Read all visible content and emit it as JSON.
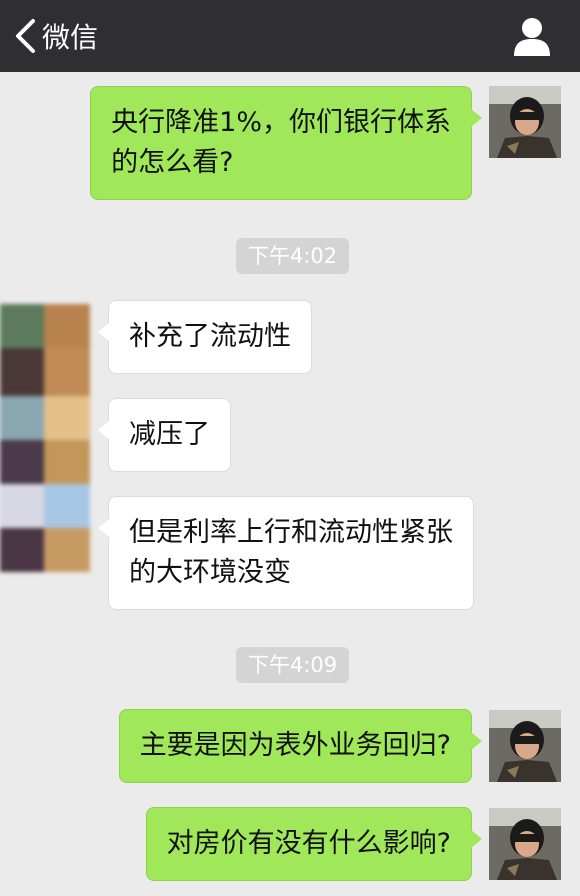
{
  "nav": {
    "back_label": "微信",
    "back_icon": "chevron-left-icon",
    "profile_icon": "person-icon",
    "bg_color": "#2f2f33"
  },
  "colors": {
    "outgoing_bubble": "#a0e75a",
    "incoming_bubble": "#ffffff",
    "chat_background": "#ebebeb",
    "timestamp_badge": "#d4d4d4"
  },
  "messages": [
    {
      "direction": "out",
      "lines": [
        "央行降准1%，你们银行体系",
        "的怎么看?"
      ]
    },
    {
      "time": "下午4:02"
    },
    {
      "direction": "in",
      "lines": [
        "补充了流动性"
      ]
    },
    {
      "direction": "in",
      "lines": [
        "减压了"
      ]
    },
    {
      "direction": "in",
      "lines": [
        "但是利率上行和流动性紧张",
        "的大环境没变"
      ]
    },
    {
      "time": "下午4:09"
    },
    {
      "direction": "out",
      "lines": [
        "主要是因为表外业务回归?"
      ]
    },
    {
      "direction": "out",
      "lines": [
        "对房价有没有什么影响?"
      ]
    }
  ]
}
